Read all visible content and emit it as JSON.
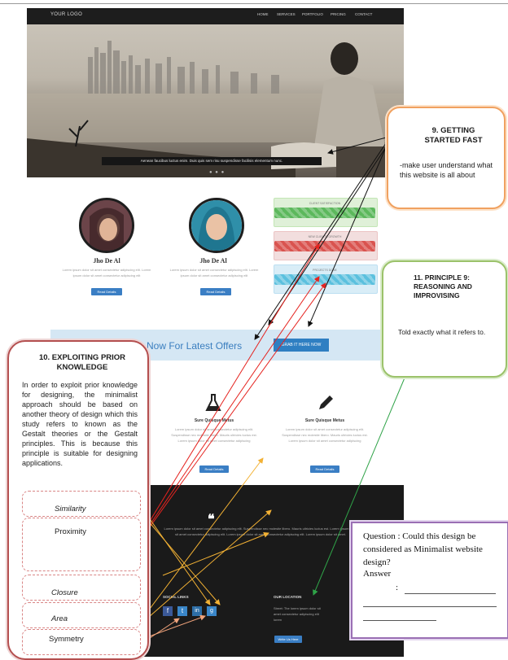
{
  "site": {
    "logo": "YOUR LOGO",
    "nav": [
      "HOME",
      "SERVICES",
      "PORTFOLIO",
      "PRICING",
      "CONTACT"
    ],
    "hero_caption": "Aenean faucibus luctus enim. Duis quis sem risu suspendisse facilisis elementum nunc.",
    "team": [
      {
        "name": "Jho  De  Al",
        "text": "Lorem ipsum dolor sit amet consectetur adipiscing elit. Lorem ipsum dolor sit amet consectetur adipiscing elit",
        "button": "Read Details"
      },
      {
        "name": "Jho  De  Al",
        "text": "Lorem ipsum dolor sit amet consectetur adipiscing elit. Lorem ipsum dolor sit amet consectetur adipiscing elit",
        "button": "Read Details"
      }
    ],
    "skills": [
      {
        "label": "CLIENT SATISFACTION",
        "color": "#5cb85c",
        "bg": "#dff0d8",
        "border": "#c3e6b5"
      },
      {
        "label": "NEW CLIENTS GROWTH",
        "color": "#d9534f",
        "bg": "#f2dede",
        "border": "#ebc4c4"
      },
      {
        "label": "PROJECTS DONE",
        "color": "#5bc0de",
        "bg": "#d9edf7",
        "border": "#bcdff1"
      }
    ],
    "offer": {
      "text": "Now For Latest Offers",
      "button": "GRAB IT HERE NOW"
    },
    "features": [
      {
        "icon": "flask-icon",
        "title": "Sure Quisque Metus",
        "text": "Lorem ipsum dolor sit amet consectetur adipiscing elit. Suspendisse nec molestie libero. Mauris ultricies luctus est. Lorem ipsum dolor sit amet consectetur adipiscing",
        "button": "Read Details"
      },
      {
        "icon": "pencil-icon",
        "title": "Sure Quisque Metus",
        "text": "Lorem ipsum dolor sit amet consectetur adipiscing elit. Suspendisse nec molestie libero. Mauris ultricies luctus est. Lorem ipsum dolor sit amet consectetur adipiscing",
        "button": "Read Details"
      }
    ],
    "testimonial": "Lorem ipsum dolor sit amet consectetur adipiscing elit. Suspendisse nec molestie libero. Mauris ultricies luctus est. Lorem ipsum dolor sit amet consectetur adipiscing elit. Lorem ipsum dolor sit amet consectetur adipiscing elit. Lorem ipsum dolor sit amet.",
    "social_title": "SOCIAL LINKS",
    "social": [
      "facebook-icon",
      "twitter-icon",
      "linkedin-icon",
      "google-plus-icon"
    ],
    "location_title": "OUR LOCATION",
    "location_text": "Street: The lorem ipsum dolor sit amet consectetur adipiscing elit lorem",
    "location_button": "Write Us Here"
  },
  "callouts": {
    "c9": {
      "title": "9.   GETTING STARTED FAST",
      "body": "-make user understand what this website is all about"
    },
    "c11": {
      "title": "11.  PRINCIPLE 9: REASONING AND IMPROVISING",
      "body": "Told exactly what it refers to."
    },
    "c10": {
      "title": "10.  EXPLOITING PRIOR KNOWLEDGE",
      "body": "In order to exploit prior knowledge for designing, the minimalist approach should be based on another theory of design which this study refers to known as the Gestalt theories or the Gestalt principles. This is because this principle is suitable for designing applications.",
      "principles": [
        "Similarity",
        "Proximity",
        "Closure",
        "Area",
        "Symmetry"
      ]
    },
    "question": {
      "text": "Question             : Could this design be considered as Minimalist website design?",
      "answer": "Answer",
      "colon": ":"
    }
  },
  "colors": {
    "c9_border": "#f0a160",
    "c10_border": "#b44f4f",
    "c11_border": "#9bc26a",
    "question_border": "#9a6fb4",
    "accent_blue": "#3a7ec4"
  }
}
